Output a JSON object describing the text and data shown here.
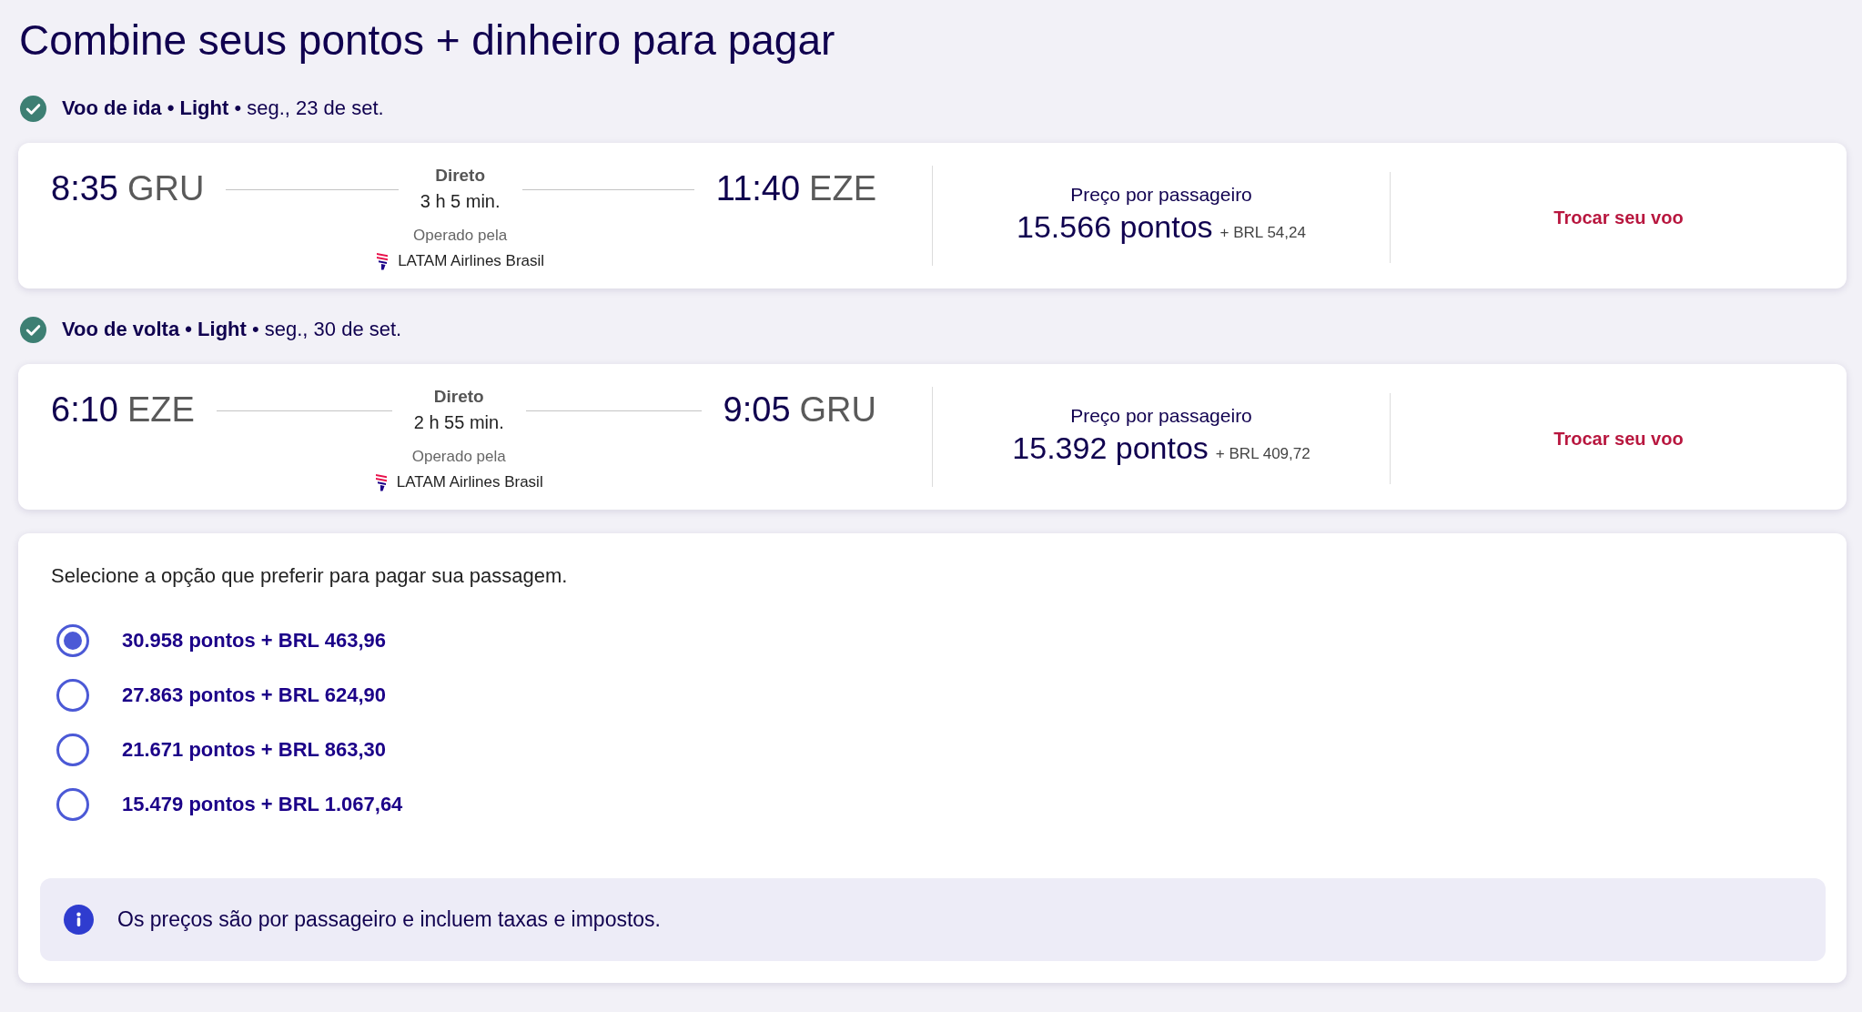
{
  "title": "Combine seus pontos + dinheiro para pagar",
  "flights": [
    {
      "confirmed": true,
      "heading": "**Voo de ida • Light** • seg., 23 de set.",
      "departure": {
        "time": "8:35",
        "airport": "GRU"
      },
      "stops": "Direto",
      "duration": "3 h 5 min.",
      "arrival": {
        "time": "11:40",
        "airport": "EZE"
      },
      "operated_by_label": "Operado pela",
      "airline": "LATAM Airlines Brasil",
      "price_label": "Preço por passageiro",
      "points": "15.566 pontos",
      "cash": "+ BRL 54,24",
      "change_link": "Trocar seu voo"
    },
    {
      "confirmed": true,
      "heading": "**Voo de volta • Light** • seg., 30 de set.",
      "departure": {
        "time": "6:10",
        "airport": "EZE"
      },
      "stops": "Direto",
      "duration": "2 h 55 min.",
      "arrival": {
        "time": "9:05",
        "airport": "GRU"
      },
      "operated_by_label": "Operado pela",
      "airline": "LATAM Airlines Brasil",
      "price_label": "Preço por passageiro",
      "points": "15.392 pontos",
      "cash": "+ BRL 409,72",
      "change_link": "Trocar seu voo"
    }
  ],
  "payment": {
    "prompt": "Selecione a opção que preferir para pagar sua passagem.",
    "options": [
      {
        "label": "30.958 pontos + BRL 463,96",
        "selected": true
      },
      {
        "label": "27.863 pontos + BRL 624,90",
        "selected": false
      },
      {
        "label": "21.671 pontos + BRL 863,30",
        "selected": false
      },
      {
        "label": "15.479 pontos + BRL 1.067,64",
        "selected": false
      }
    ],
    "info": "Os preços são por passageiro e incluem taxas e impostos."
  }
}
